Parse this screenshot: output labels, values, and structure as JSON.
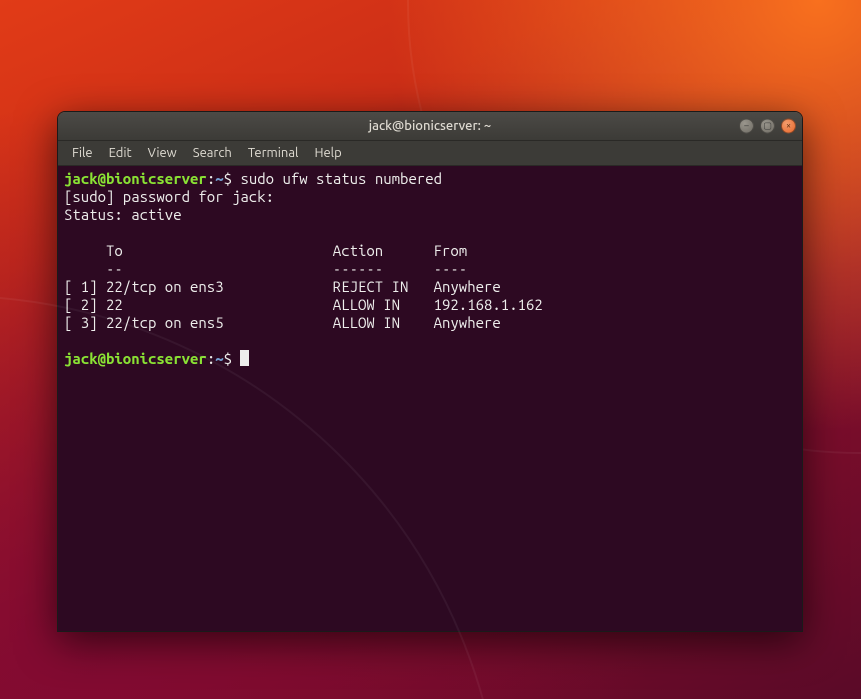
{
  "window": {
    "title": "jack@bionicserver: ~"
  },
  "menubar": {
    "items": [
      "File",
      "Edit",
      "View",
      "Search",
      "Terminal",
      "Help"
    ]
  },
  "prompt": {
    "user_host": "jack@bionicserver",
    "colon": ":",
    "path": "~",
    "sigil": "$ "
  },
  "session": {
    "command1": "sudo ufw status numbered",
    "line_sudo": "[sudo] password for jack: ",
    "line_status": "Status: active",
    "blank": "",
    "hdr": "     To                         Action      From",
    "sep": "     --                         ------      ----",
    "r1": "[ 1] 22/tcp on ens3             REJECT IN   Anywhere",
    "r2": "[ 2] 22                         ALLOW IN    192.168.1.162",
    "r3": "[ 3] 22/tcp on ens5             ALLOW IN    Anywhere"
  },
  "controls": {
    "min_glyph": "–",
    "max_glyph": "▢",
    "close_glyph": "×"
  },
  "chart_data": {
    "type": "table",
    "title": "ufw status numbered",
    "columns": [
      "#",
      "To",
      "Action",
      "From"
    ],
    "rows": [
      [
        1,
        "22/tcp on ens3",
        "REJECT IN",
        "Anywhere"
      ],
      [
        2,
        "22",
        "ALLOW IN",
        "192.168.1.162"
      ],
      [
        3,
        "22/tcp on ens5",
        "ALLOW IN",
        "Anywhere"
      ]
    ],
    "status": "active"
  }
}
